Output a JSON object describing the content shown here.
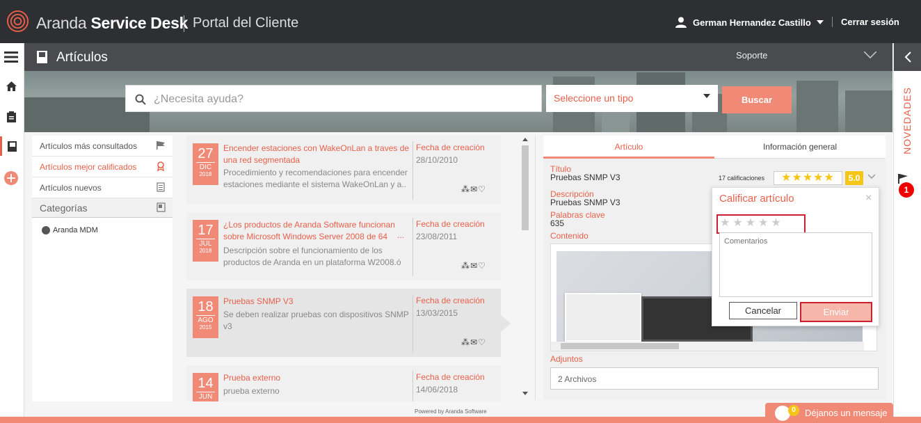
{
  "app": {
    "brand_light": "Aranda",
    "brand_bold": "Service Desk",
    "portal": "Portal del Cliente"
  },
  "header": {
    "user_name": "German Hernandez Castillo",
    "logout": "Cerrar sesión"
  },
  "subbar": {
    "title": "Artículos",
    "dropdown_value": "Soporte"
  },
  "search": {
    "placeholder": "¿Necesita ayuda?",
    "type_select": "Seleccione un tipo",
    "button": "Buscar"
  },
  "right_rail": {
    "label": "NOVEDADES",
    "badge_count": "1"
  },
  "left_nav": {
    "items": [
      {
        "label": "Artículos más consultados",
        "icon": "flag-icon"
      },
      {
        "label": "Artículos mejor calificados",
        "icon": "award-icon"
      },
      {
        "label": "Artículos nuevos",
        "icon": "document-icon"
      }
    ],
    "categories_title": "Categorías",
    "categories": [
      {
        "label": "Aranda MDM"
      }
    ]
  },
  "articles": [
    {
      "day": "27",
      "month": "DIC",
      "year": "2018",
      "title": "Encender estaciones con WakeOnLan a traves de una red segmentada",
      "desc": "Procedimiento y recomendaciones para encender estaciones mediante el sistema WakeOnLan y a..",
      "date_label": "Fecha de creación",
      "date": "28/10/2010"
    },
    {
      "day": "17",
      "month": "JUL",
      "year": "2018",
      "title": "¿Los productos de Aranda Software funcionan sobre Microsoft Windows Server 2008 de 64",
      "ellipsis": "...",
      "desc": "Descripción sobre el funcionamiento de los productos de Aranda en un plataforma W2008.ó",
      "date_label": "Fecha de creación",
      "date": "23/08/2011"
    },
    {
      "day": "18",
      "month": "AGO",
      "year": "2015",
      "title": "Pruebas SNMP V3",
      "desc": "Se deben realizar pruebas con dispositivos SNMP v3",
      "date_label": "Fecha de creación",
      "date": "13/03/2015"
    },
    {
      "day": "14",
      "month": "JUN",
      "year": "",
      "title": "Prueba externo",
      "desc": "prueba externo",
      "date_label": "Fecha de creación",
      "date": "14/06/2018"
    }
  ],
  "detail": {
    "tabs": [
      "Artículo",
      "Información general"
    ],
    "title_label": "Título",
    "title_value": "Pruebas SNMP V3",
    "ratings_count": "17 calificaciones",
    "rating_value": 5,
    "score": "5.0",
    "desc_label": "Descripción",
    "desc_value": "Pruebas SNMP V3",
    "keywords_label": "Palabras clave",
    "keywords_value": "635",
    "content_label": "Contenido",
    "attachments_label": "Adjuntos",
    "attachments_value": "2 Archivos"
  },
  "rate_popup": {
    "title": "Calificar artículo",
    "comments_placeholder": "Comentarios",
    "cancel": "Cancelar",
    "submit": "Enviar",
    "selected_stars": 0
  },
  "footer": {
    "powered": "Powered by Aranda Software",
    "message_button": "Déjanos un mensaje",
    "message_count": "0"
  },
  "colors": {
    "accent": "#f08a76",
    "accent_text": "#e85f4a",
    "dark": "#2e2f33",
    "highlight_border": "#cc1f2f",
    "star": "#f5c518"
  }
}
